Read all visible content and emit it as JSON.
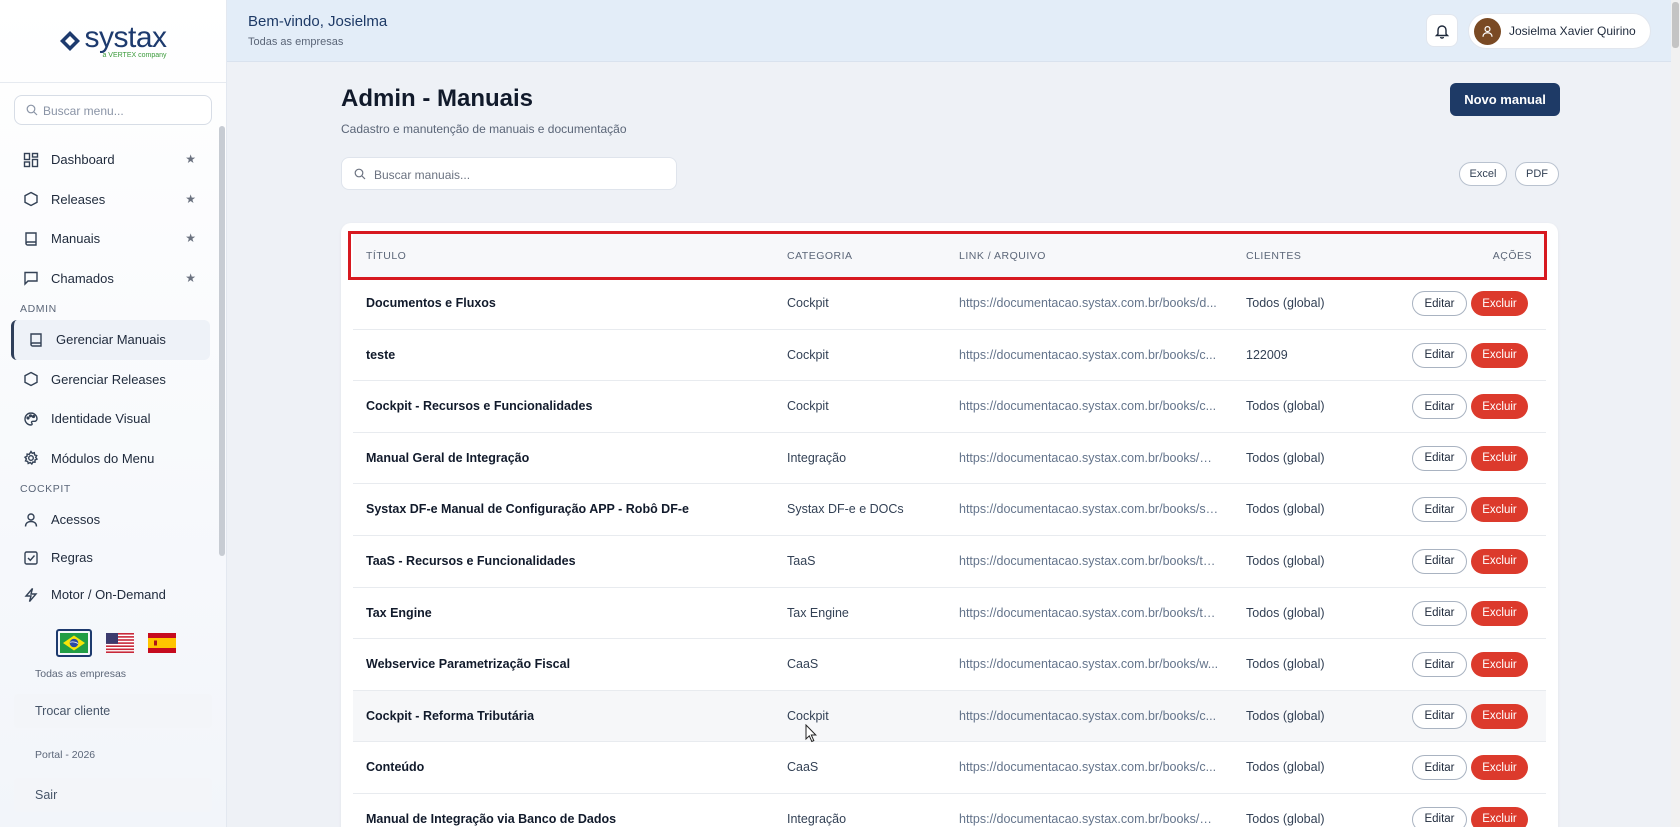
{
  "brand": {
    "name": "systax",
    "tagline": "a VERTEX company"
  },
  "sidebar": {
    "search_placeholder": "Buscar menu...",
    "items": [
      {
        "label": "Dashboard",
        "icon": "dashboard-icon",
        "starred": true
      },
      {
        "label": "Releases",
        "icon": "hexagon-icon",
        "starred": true
      },
      {
        "label": "Manuais",
        "icon": "book-icon",
        "starred": true
      },
      {
        "label": "Chamados",
        "icon": "chat-icon",
        "starred": true
      }
    ],
    "admin_label": "ADMIN",
    "admin_items": [
      {
        "label": "Gerenciar Manuais",
        "icon": "book-icon",
        "active": true
      },
      {
        "label": "Gerenciar Releases",
        "icon": "hexagon-icon"
      },
      {
        "label": "Identidade Visual",
        "icon": "palette-icon"
      },
      {
        "label": "Módulos do Menu",
        "icon": "gear-icon"
      }
    ],
    "cockpit_label": "COCKPIT",
    "cockpit_items": [
      {
        "label": "Acessos",
        "icon": "user-icon"
      },
      {
        "label": "Regras",
        "icon": "checkbox-icon"
      },
      {
        "label": "Motor / On-Demand",
        "icon": "bolt-icon"
      }
    ],
    "company_text": "Todas as empresas",
    "switch_client": "Trocar cliente",
    "portal_year": "Portal - 2026",
    "logout": "Sair",
    "star_glyph": "★"
  },
  "header": {
    "welcome": "Bem-vindo, Josielma",
    "company": "Todas as empresas",
    "user_name": "Josielma Xavier Quirino"
  },
  "main": {
    "title": "Admin - Manuais",
    "subtitle": "Cadastro e manutenção de manuais e documentação",
    "new_button": "Novo manual",
    "search_placeholder": "Buscar manuais...",
    "export_excel": "Excel",
    "export_pdf": "PDF"
  },
  "table": {
    "columns": [
      "TÍTULO",
      "CATEGORIA",
      "LINK / ARQUIVO",
      "CLIENTES",
      "AÇÕES"
    ],
    "edit_label": "Editar",
    "delete_label": "Excluir",
    "rows": [
      {
        "title": "Documentos e Fluxos",
        "category": "Cockpit",
        "link": "https://documentacao.systax.com.br/books/d...",
        "clients": "Todos (global)"
      },
      {
        "title": "teste",
        "category": "Cockpit",
        "link": "https://documentacao.systax.com.br/books/c...",
        "clients": "122009"
      },
      {
        "title": "Cockpit - Recursos e Funcionalidades",
        "category": "Cockpit",
        "link": "https://documentacao.systax.com.br/books/c...",
        "clients": "Todos (global)"
      },
      {
        "title": "Manual Geral de Integração",
        "category": "Integração",
        "link": "https://documentacao.systax.com.br/books/m...",
        "clients": "Todos (global)"
      },
      {
        "title": "Systax DF-e Manual de Configuração APP - Robô DF-e",
        "category": "Systax DF-e e DOCs",
        "link": "https://documentacao.systax.com.br/books/sy...",
        "clients": "Todos (global)"
      },
      {
        "title": "TaaS - Recursos e Funcionalidades",
        "category": "TaaS",
        "link": "https://documentacao.systax.com.br/books/ta...",
        "clients": "Todos (global)"
      },
      {
        "title": "Tax Engine",
        "category": "Tax Engine",
        "link": "https://documentacao.systax.com.br/books/ta...",
        "clients": "Todos (global)"
      },
      {
        "title": "Webservice Parametrização Fiscal",
        "category": "CaaS",
        "link": "https://documentacao.systax.com.br/books/w...",
        "clients": "Todos (global)"
      },
      {
        "title": "Cockpit - Reforma Tributária",
        "category": "Cockpit",
        "link": "https://documentacao.systax.com.br/books/c...",
        "clients": "Todos (global)"
      },
      {
        "title": "Conteúdo",
        "category": "CaaS",
        "link": "https://documentacao.systax.com.br/books/c...",
        "clients": "Todos (global)"
      },
      {
        "title": "Manual de Integração via Banco de Dados",
        "category": "Integração",
        "link": "https://documentacao.systax.com.br/books/m...",
        "clients": "Todos (global)"
      }
    ]
  },
  "colors": {
    "primary": "#1e3a66",
    "danger": "#dc3a2c",
    "highlight": "#d71920"
  }
}
